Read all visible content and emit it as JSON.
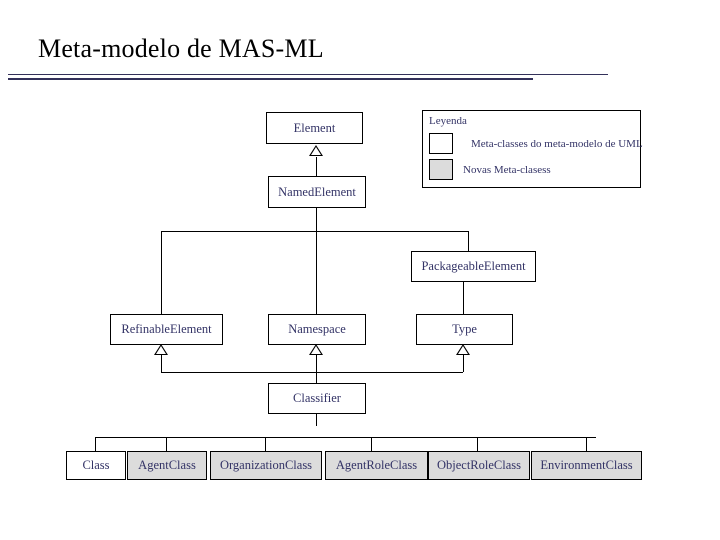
{
  "slide": {
    "title": "Meta-modelo de MAS-ML",
    "background_color": "#ffffff",
    "rule_color": "#33315a"
  },
  "legend": {
    "title": "Leyenda",
    "entries": [
      {
        "label": "Meta-classes do meta-modelo de UML",
        "swatch": "white",
        "color": "#ffffff"
      },
      {
        "label": "Novas Meta-clasess",
        "swatch": "shaded",
        "color": "#dcdcdc"
      }
    ]
  },
  "diagram": {
    "text_color": "#333366",
    "line_color": "#000000",
    "shaded_fill": "#dcdcdc",
    "plain_fill": "#ffffff",
    "nodes": [
      {
        "id": "element",
        "label": "Element",
        "shaded": false
      },
      {
        "id": "named_element",
        "label": "NamedElement",
        "shaded": false
      },
      {
        "id": "packageable_element",
        "label": "PackageableElement",
        "shaded": false
      },
      {
        "id": "refinable_element",
        "label": "RefinableElement",
        "shaded": false
      },
      {
        "id": "namespace",
        "label": "Namespace",
        "shaded": false
      },
      {
        "id": "type",
        "label": "Type",
        "shaded": false
      },
      {
        "id": "classifier",
        "label": "Classifier",
        "shaded": false
      },
      {
        "id": "class",
        "label": "Class",
        "shaded": false
      },
      {
        "id": "agent_class",
        "label": "AgentClass",
        "shaded": true
      },
      {
        "id": "organization_class",
        "label": "OrganizationClass",
        "shaded": true
      },
      {
        "id": "agent_role_class",
        "label": "AgentRoleClass",
        "shaded": true
      },
      {
        "id": "object_role_class",
        "label": "ObjectRoleClass",
        "shaded": true
      },
      {
        "id": "environment_class",
        "label": "EnvironmentClass",
        "shaded": true
      }
    ],
    "generalizations": [
      {
        "from": "named_element",
        "to": "element"
      },
      {
        "from": "refinable_element",
        "to": "named_element"
      },
      {
        "from": "namespace",
        "to": "named_element"
      },
      {
        "from": "packageable_element",
        "to": "named_element"
      },
      {
        "from": "type",
        "to": "packageable_element"
      },
      {
        "from": "classifier",
        "to": "refinable_element"
      },
      {
        "from": "classifier",
        "to": "namespace"
      },
      {
        "from": "classifier",
        "to": "type"
      },
      {
        "from": "class",
        "to": "classifier"
      },
      {
        "from": "agent_class",
        "to": "classifier"
      },
      {
        "from": "organization_class",
        "to": "classifier"
      },
      {
        "from": "agent_role_class",
        "to": "classifier"
      },
      {
        "from": "object_role_class",
        "to": "classifier"
      },
      {
        "from": "environment_class",
        "to": "classifier"
      }
    ]
  }
}
